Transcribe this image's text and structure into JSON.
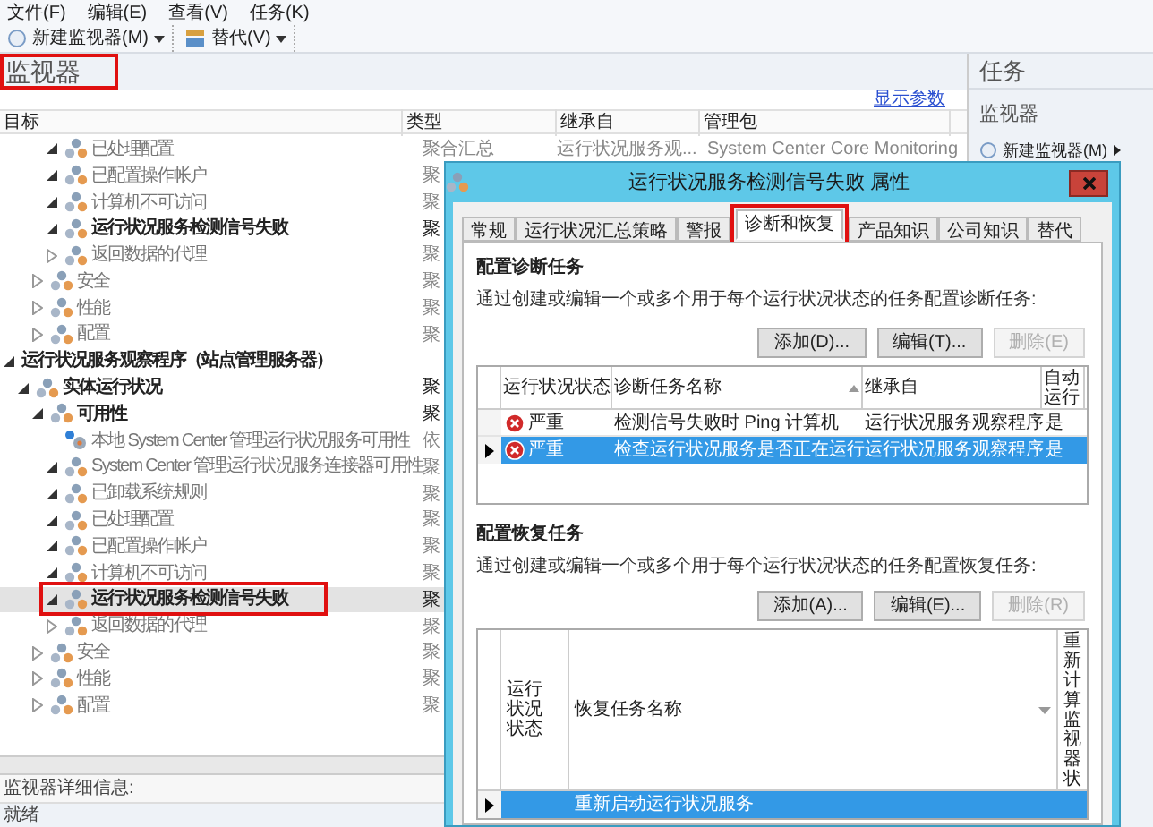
{
  "menu": [
    "文件(F)",
    "编辑(E)",
    "查看(V)",
    "任务(K)"
  ],
  "toolbar": [
    {
      "kind": "new",
      "label": "新建监视器(M)"
    },
    {
      "kind": "override",
      "label": "替代(V)"
    }
  ],
  "pane_title": {
    "text": "监视器",
    "highlighted": true
  },
  "show_params_link": "显示参数",
  "columns": [
    "目标",
    "类型",
    "继承自",
    "管理包"
  ],
  "tree": [
    {
      "children": [
        {
          "children": [
            {
              "children": [
                {
                  "label": "已处理配置",
                  "type": "聚合汇总",
                  "inherited_from": "运行状况服务观...",
                  "management_pack": "System Center Core Monitoring",
                  "kind": "aggregate",
                  "expanded": true,
                  "bold": false,
                  "selected": false,
                  "highlighted": false
                },
                {
                  "label": "已配置操作帐户",
                  "type": "聚",
                  "kind": "aggregate",
                  "expanded": true,
                  "bold": false,
                  "selected": false,
                  "highlighted": false
                },
                {
                  "label": "计算机不可访问",
                  "type": "聚",
                  "kind": "aggregate",
                  "expanded": true,
                  "bold": false,
                  "selected": false,
                  "highlighted": false
                },
                {
                  "label": "运行状况服务检测信号失败",
                  "type": "聚",
                  "kind": "aggregate",
                  "expanded": true,
                  "bold": true,
                  "selected": false,
                  "highlighted": false
                },
                {
                  "label": "返回数据的代理",
                  "type": "聚",
                  "kind": "aggregate",
                  "expanded": false,
                  "bold": false,
                  "selected": false,
                  "highlighted": false
                }
              ]
            },
            {
              "label": "安全",
              "type": "聚",
              "kind": "aggregate",
              "expanded": false,
              "bold": false,
              "selected": false,
              "highlighted": false
            },
            {
              "label": "性能",
              "type": "聚",
              "kind": "aggregate",
              "expanded": false,
              "bold": false,
              "selected": false,
              "highlighted": false
            },
            {
              "label": "配置",
              "type": "聚",
              "kind": "aggregate",
              "expanded": false,
              "bold": false,
              "selected": false,
              "highlighted": false
            }
          ]
        }
      ]
    },
    {
      "label": "运行状况服务观察程序（站点管理服务器）",
      "expanded": true,
      "bold": true,
      "selected": false,
      "highlighted": false,
      "children": [
        {
          "label": "实体运行状况",
          "type": "聚",
          "kind": "aggregate",
          "expanded": true,
          "bold": true,
          "selected": false,
          "highlighted": false,
          "children": [
            {
              "label": "可用性",
              "type": "聚",
              "kind": "aggregate",
              "expanded": true,
              "bold": true,
              "selected": false,
              "highlighted": false,
              "children": [
                {
                  "label": "本地 System Center 管理运行状况服务可用性",
                  "type": "依",
                  "kind": "dependency",
                  "bold": false,
                  "selected": false,
                  "highlighted": false
                },
                {
                  "label": "System Center 管理运行状况服务连接器可用性",
                  "type": "聚",
                  "kind": "aggregate",
                  "expanded": true,
                  "bold": false,
                  "selected": false,
                  "highlighted": false
                },
                {
                  "label": "已卸载系统规则",
                  "type": "聚",
                  "kind": "aggregate",
                  "expanded": true,
                  "bold": false,
                  "selected": false,
                  "highlighted": false
                },
                {
                  "label": "已处理配置",
                  "type": "聚",
                  "kind": "aggregate",
                  "expanded": true,
                  "bold": false,
                  "selected": false,
                  "highlighted": false
                },
                {
                  "label": "已配置操作帐户",
                  "type": "聚",
                  "kind": "aggregate",
                  "expanded": true,
                  "bold": false,
                  "selected": false,
                  "highlighted": false
                },
                {
                  "label": "计算机不可访问",
                  "type": "聚",
                  "kind": "aggregate",
                  "expanded": true,
                  "bold": false,
                  "selected": false,
                  "highlighted": false
                },
                {
                  "label": "运行状况服务检测信号失败",
                  "type": "聚",
                  "kind": "aggregate",
                  "expanded": true,
                  "bold": true,
                  "selected": true,
                  "highlighted": true
                },
                {
                  "label": "返回数据的代理",
                  "type": "聚",
                  "kind": "aggregate",
                  "expanded": false,
                  "bold": false,
                  "selected": false,
                  "highlighted": false
                }
              ]
            },
            {
              "label": "安全",
              "type": "聚",
              "kind": "aggregate",
              "expanded": false,
              "bold": false,
              "selected": false,
              "highlighted": false
            },
            {
              "label": "性能",
              "type": "聚",
              "kind": "aggregate",
              "expanded": false,
              "bold": false,
              "selected": false,
              "highlighted": false
            },
            {
              "label": "配置",
              "type": "聚",
              "kind": "aggregate",
              "expanded": false,
              "bold": false,
              "selected": false,
              "highlighted": false
            }
          ]
        }
      ]
    }
  ],
  "details_label": "监视器详细信息:",
  "status_bar": "就绪",
  "tasks_pane": {
    "title": "任务",
    "section": "监视器",
    "items": [
      "新建监视器(M)"
    ]
  },
  "dialog": {
    "title": "运行状况服务检测信号失败 属性",
    "tabs": [
      {
        "label": "常规",
        "selected": false,
        "highlighted": false
      },
      {
        "label": "运行状况汇总策略",
        "selected": false,
        "highlighted": false
      },
      {
        "label": "警报",
        "selected": false,
        "highlighted": false
      },
      {
        "label": "诊断和恢复",
        "selected": true,
        "highlighted": true
      },
      {
        "label": "产品知识",
        "selected": false,
        "highlighted": false
      },
      {
        "label": "公司知识",
        "selected": false,
        "highlighted": false
      },
      {
        "label": "替代",
        "selected": false,
        "highlighted": false
      }
    ],
    "diagnostic": {
      "heading": "配置诊断任务",
      "description": "通过创建或编辑一个或多个用于每个运行状况状态的任务配置诊断任务:",
      "buttons": [
        {
          "label": "添加(D)...",
          "disabled": false
        },
        {
          "label": "编辑(T)...",
          "disabled": false
        },
        {
          "label": "删除(E)",
          "disabled": true
        }
      ],
      "columns": [
        "运行状况状态",
        "诊断任务名称",
        "继承自",
        "自动运行"
      ],
      "rows": [
        {
          "state": "严重",
          "name": "检测信号失败时 Ping 计算机",
          "inherited_from": "运行状况服务观察程序",
          "auto": "是",
          "selected": false
        },
        {
          "state": "严重",
          "name": "检查运行状况服务是否正在运行",
          "inherited_from": "运行状况服务观察程序",
          "auto": "是",
          "selected": true
        }
      ]
    },
    "recovery": {
      "heading": "配置恢复任务",
      "description": "通过创建或编辑一个或多个用于每个运行状况状态的任务配置恢复任务:",
      "buttons": [
        {
          "label": "添加(A)...",
          "disabled": false
        },
        {
          "label": "编辑(E)...",
          "disabled": false
        },
        {
          "label": "删除(R)",
          "disabled": true
        }
      ],
      "columns": [
        "运行状况状态",
        "恢复任务名称",
        "重新计算监视器状"
      ],
      "rows": [
        {
          "name": "重新启动运行状况服务",
          "selected": true
        }
      ]
    }
  }
}
